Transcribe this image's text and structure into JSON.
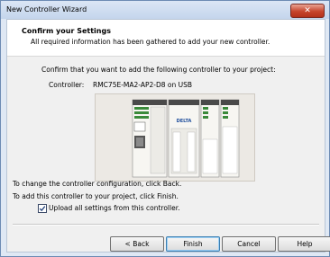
{
  "window": {
    "title": "New Controller Wizard",
    "close_glyph": "✕"
  },
  "header": {
    "title": "Confirm your Settings",
    "subtitle": "All required information has been gathered to add your new controller."
  },
  "body": {
    "confirm_text": "Confirm that you want to add the following controller to your project:",
    "controller_label": "Controller:",
    "controller_value": "RMC75E-MA2-AP2-D8 on USB",
    "change_text": "To change the controller configuration, click Back.",
    "finish_text": "To add this controller to your project, click Finish.",
    "upload_checkbox_label": "Upload all settings from this controller.",
    "upload_checked": true,
    "device_logo_text": "DELTA"
  },
  "buttons": {
    "back": "< Back",
    "finish": "Finish",
    "cancel": "Cancel",
    "help": "Help"
  },
  "colors": {
    "accent": "#1f4e9c",
    "close_red": "#c6442c"
  }
}
